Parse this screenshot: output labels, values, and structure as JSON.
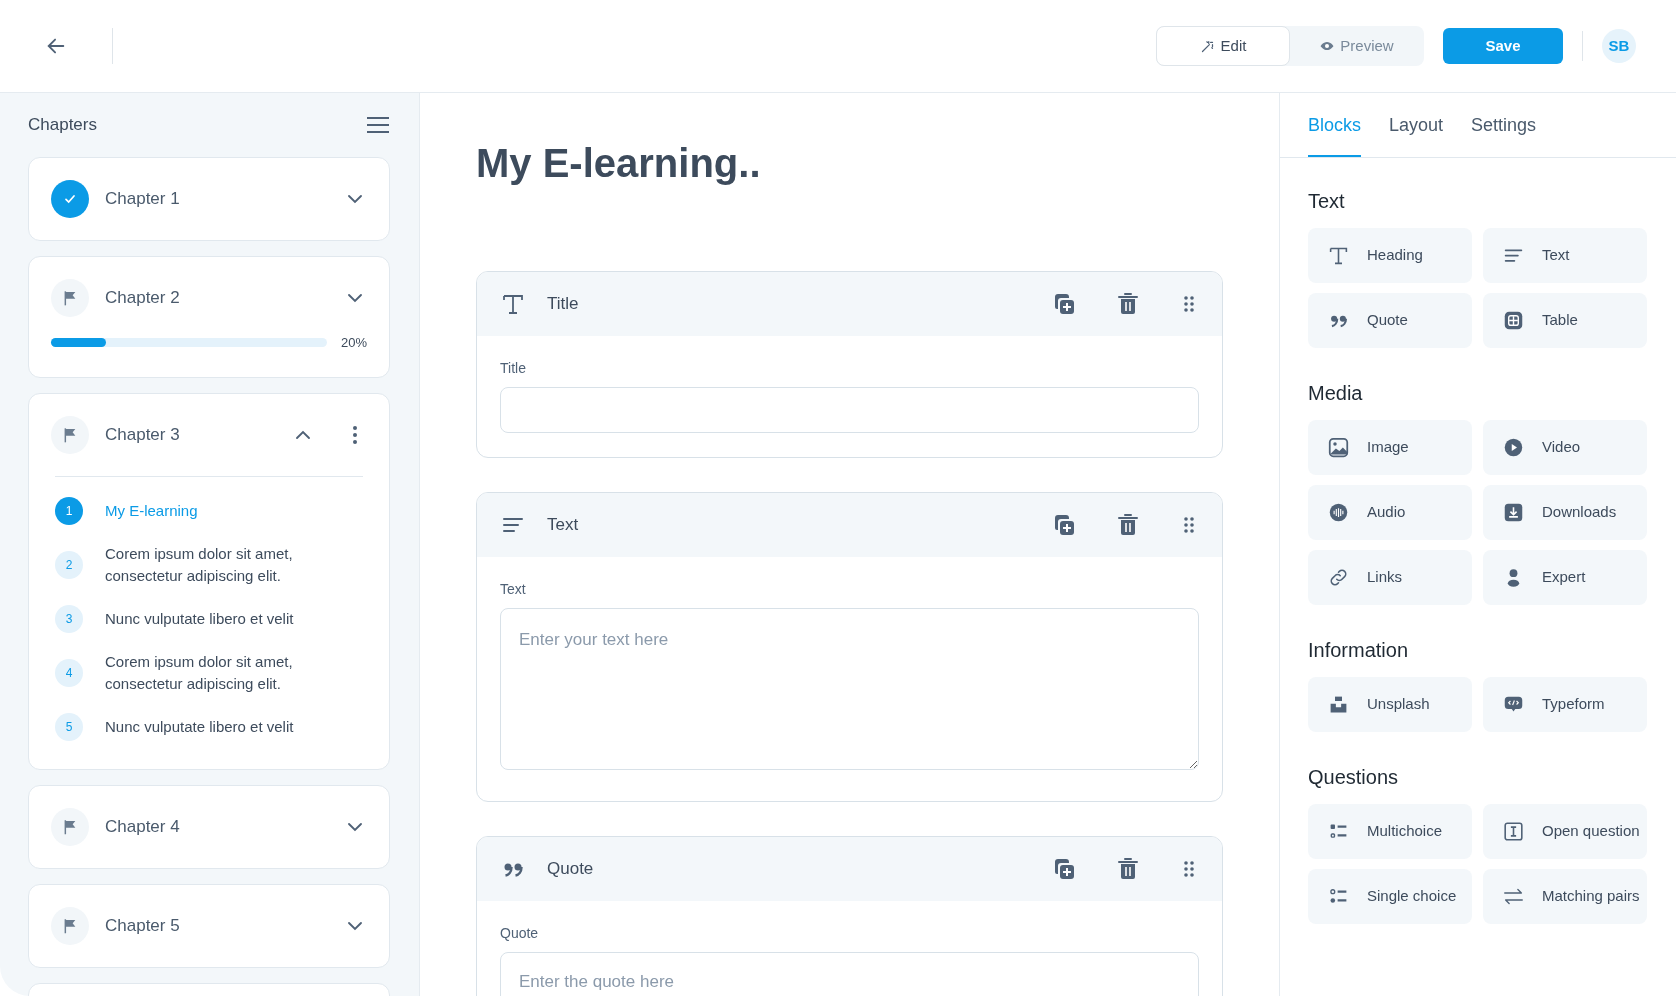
{
  "toolbar": {
    "mode_tabs": [
      {
        "label": "Edit",
        "kind": "edit",
        "selected": true
      },
      {
        "label": "Preview",
        "kind": "preview",
        "selected": false
      }
    ],
    "save_button": "Save",
    "avatar": "SB"
  },
  "chapters_panel": {
    "title": "Chapters",
    "chapters": [
      {
        "title": "Chapter 1",
        "completed": true,
        "expanded": false
      },
      {
        "title": "Chapter 2",
        "completed": false,
        "expanded": false,
        "level": 0.2,
        "reading": "20%"
      },
      {
        "title": "Chapter 3",
        "completed": false,
        "expanded": true,
        "lessons": [
          {
            "number": "1",
            "title": "My E-learning",
            "selected": true
          },
          {
            "number": "2",
            "title": "Corem ipsum dolor sit amet, consectetur adipiscing elit.",
            "selected": false
          },
          {
            "number": "3",
            "title": "Nunc vulputate libero et velit",
            "selected": false
          },
          {
            "number": "4",
            "title": "Corem ipsum dolor sit amet, consectetur adipiscing elit.",
            "selected": false
          },
          {
            "number": "5",
            "title": "Nunc vulputate libero et velit",
            "selected": false
          }
        ]
      },
      {
        "title": "Chapter 4",
        "completed": false,
        "expanded": false
      },
      {
        "title": "Chapter 5",
        "completed": false,
        "expanded": false
      }
    ]
  },
  "editor": {
    "page_title": "My E-learning..",
    "blocks": [
      {
        "kind": "title",
        "header": "Title",
        "field_label": "Title"
      },
      {
        "kind": "text",
        "header": "Text",
        "field_label": "Text",
        "placeholder": "Enter your text here"
      },
      {
        "kind": "quote",
        "header": "Quote",
        "field_label": "Quote",
        "placeholder": "Enter the quote here"
      }
    ]
  },
  "blocks_panel": {
    "tabs": [
      {
        "label": "Blocks",
        "selected": true
      },
      {
        "label": "Layout",
        "selected": false
      },
      {
        "label": "Settings",
        "selected": false
      }
    ],
    "sections": [
      {
        "title": "Text",
        "items": [
          {
            "label": "Heading",
            "kind": "heading"
          },
          {
            "label": "Text",
            "kind": "text"
          },
          {
            "label": "Quote",
            "kind": "quote"
          },
          {
            "label": "Table",
            "kind": "table"
          }
        ]
      },
      {
        "title": "Media",
        "items": [
          {
            "label": "Image",
            "kind": "image"
          },
          {
            "label": "Video",
            "kind": "video"
          },
          {
            "label": "Audio",
            "kind": "audio"
          },
          {
            "label": "Downloads",
            "kind": "downloads"
          },
          {
            "label": "Links",
            "kind": "links"
          },
          {
            "label": "Expert",
            "kind": "expert"
          }
        ]
      },
      {
        "title": "Information",
        "items": [
          {
            "label": "Unsplash",
            "kind": "unsplash"
          },
          {
            "label": "Typeform",
            "kind": "typeform"
          }
        ]
      },
      {
        "title": "Questions",
        "items": [
          {
            "label": "Multichoice",
            "kind": "multichoice"
          },
          {
            "label": "Open question",
            "kind": "open"
          },
          {
            "label": "Single choice",
            "kind": "single"
          },
          {
            "label": "Matching pairs",
            "kind": "matching"
          }
        ]
      }
    ]
  }
}
